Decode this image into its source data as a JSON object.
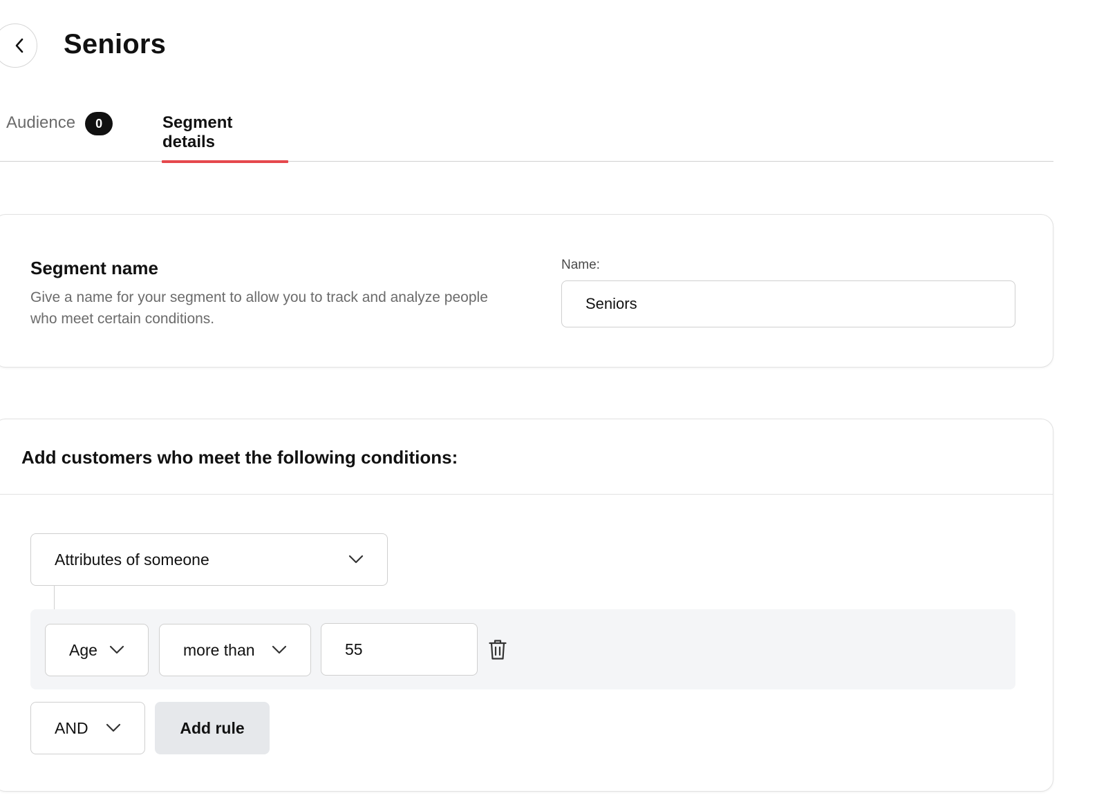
{
  "header": {
    "title": "Seniors",
    "back_icon": "chevron-left-icon"
  },
  "tabs": [
    {
      "label": "Audience",
      "badge": "0",
      "active": false
    },
    {
      "label": "Segment details",
      "active": true
    }
  ],
  "colors": {
    "accent": "#e5484d",
    "badge_bg": "#111111",
    "panel_bg": "#f4f5f7",
    "button_bg": "#e6e8eb"
  },
  "segment_name": {
    "title": "Segment name",
    "description": "Give a name for your segment to allow you to track and analyze people who meet certain conditions.",
    "field_label": "Name:",
    "field_value": "Seniors"
  },
  "conditions": {
    "title": "Add customers who meet the following conditions:",
    "group_type": "Attributes of someone",
    "rules": [
      {
        "attribute": "Age",
        "operator": "more than",
        "value": "55",
        "delete_icon": "trash-icon"
      }
    ],
    "combinator": "AND",
    "add_rule_label": "Add rule"
  }
}
